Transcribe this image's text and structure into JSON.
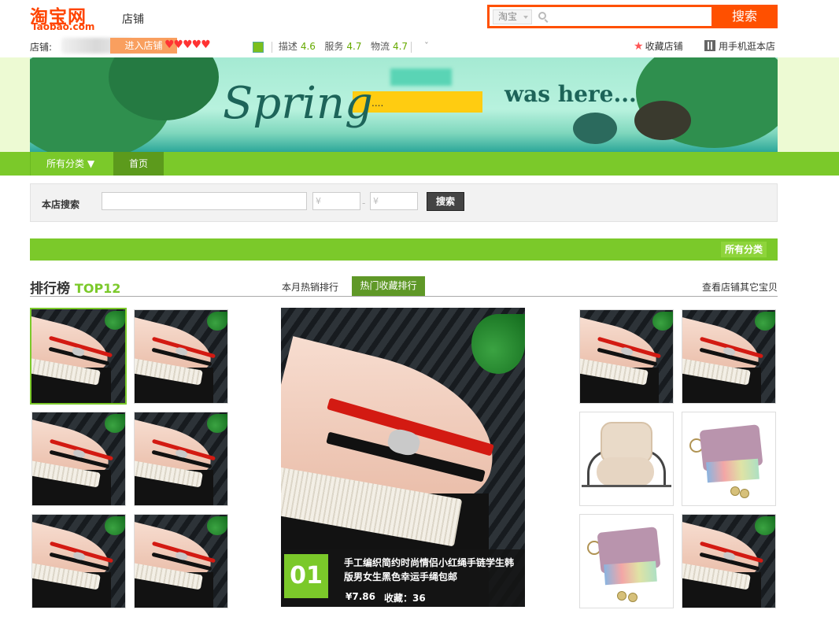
{
  "header": {
    "logo_cn": "淘宝网",
    "logo_en": "Taobao.com",
    "shop_label": "店铺",
    "search_scope": "淘宝",
    "search_button": "搜索"
  },
  "shop_bar": {
    "shop_prefix": "店铺:",
    "enter_shop": "进入店铺",
    "hearts": "♥♥♥♥♥",
    "ratings": [
      {
        "label": "描述",
        "value": "4.6"
      },
      {
        "label": "服务",
        "value": "4.7"
      },
      {
        "label": "物流",
        "value": "4.7"
      }
    ],
    "favorite_shop": "收藏店铺",
    "mobile_shop": "用手机逛本店"
  },
  "banner": {
    "spring_text": "Spring",
    "was_here": "was here...",
    "yellow_text": "...."
  },
  "nav": {
    "all_categories": "所有分类",
    "home": "首页"
  },
  "shop_search": {
    "label": "本店搜索",
    "price_min_placeholder": "¥",
    "price_max_placeholder": "¥",
    "button": "搜索"
  },
  "category_bar": {
    "label": "所有分类"
  },
  "ranking": {
    "title": "排行榜",
    "title_suffix": "TOP12",
    "tab_month_sales": "本月热销排行",
    "tab_hot_favorites": "热门收藏排行",
    "view_more": "查看店铺其它宝贝"
  },
  "featured": {
    "rank": "01",
    "title": "手工编织简约时尚情侣小红绳手链学生韩版男女生黑色幸运手绳包邮",
    "price": "¥7.86",
    "favorites": "收藏：36"
  },
  "colors": {
    "taobao_orange": "#ff5000",
    "shop_green": "#7bc92a",
    "dark_green": "#5f9827"
  }
}
